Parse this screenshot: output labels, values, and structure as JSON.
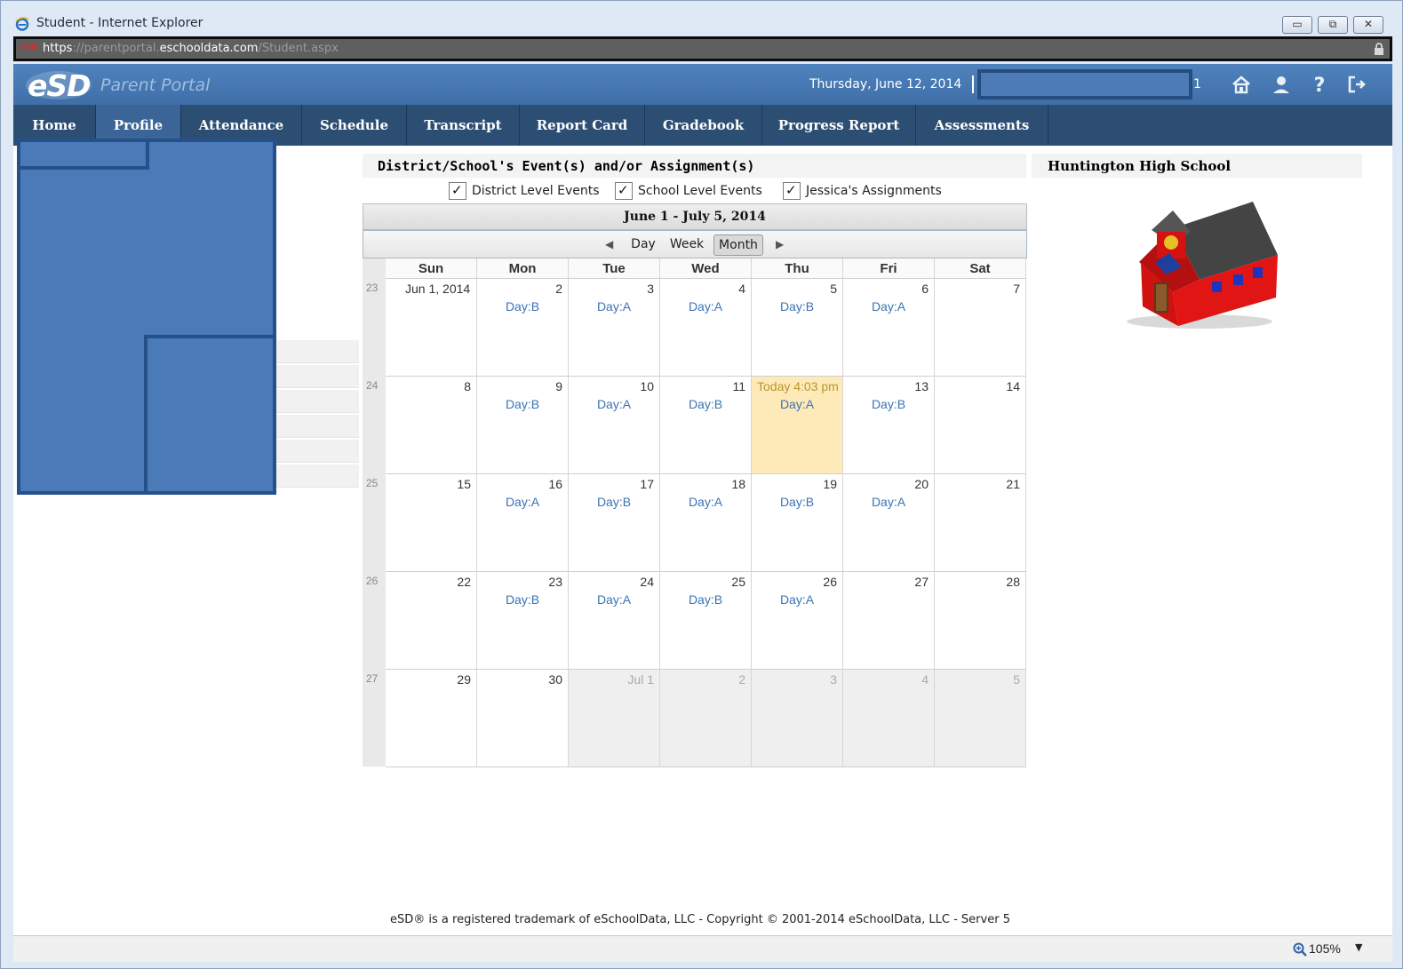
{
  "window": {
    "title": "Student - Internet Explorer",
    "url_scheme": "https",
    "url_pre": "://parentportal.",
    "url_domain": "eschooldata.com",
    "url_path": "/Student.aspx",
    "site_badge": "eSD"
  },
  "header": {
    "logo": "eSD",
    "portal_name": "Parent Portal",
    "date": "Thursday, June 12, 2014",
    "user_suffix": "1"
  },
  "nav": {
    "items": [
      {
        "label": "Home"
      },
      {
        "label": "Profile",
        "active": true
      },
      {
        "label": "Attendance"
      },
      {
        "label": "Schedule"
      },
      {
        "label": "Transcript"
      },
      {
        "label": "Report Card"
      },
      {
        "label": "Gradebook"
      },
      {
        "label": "Progress Report"
      },
      {
        "label": "Assessments"
      }
    ]
  },
  "events": {
    "title": "District/School's Event(s) and/or Assignment(s)",
    "filters": [
      {
        "label": "District Level Events",
        "checked": true
      },
      {
        "label": "School Level Events",
        "checked": true
      },
      {
        "label": "Jessica's Assignments",
        "checked": true
      }
    ]
  },
  "calendar": {
    "range": "June 1 - July 5, 2014",
    "views": [
      "Day",
      "Week",
      "Month"
    ],
    "active_view": "Month",
    "days": [
      "Sun",
      "Mon",
      "Tue",
      "Wed",
      "Thu",
      "Fri",
      "Sat"
    ],
    "weeks": [
      {
        "num": "23",
        "cells": [
          {
            "label": "Jun 1, 2014"
          },
          {
            "label": "2",
            "event": "Day:B"
          },
          {
            "label": "3",
            "event": "Day:A"
          },
          {
            "label": "4",
            "event": "Day:A"
          },
          {
            "label": "5",
            "event": "Day:B"
          },
          {
            "label": "6",
            "event": "Day:A"
          },
          {
            "label": "7"
          }
        ]
      },
      {
        "num": "24",
        "cells": [
          {
            "label": "8"
          },
          {
            "label": "9",
            "event": "Day:B"
          },
          {
            "label": "10",
            "event": "Day:A"
          },
          {
            "label": "11",
            "event": "Day:B"
          },
          {
            "label": "Today 4:03 pm",
            "event": "Day:A",
            "today": true
          },
          {
            "label": "13",
            "event": "Day:B"
          },
          {
            "label": "14"
          }
        ]
      },
      {
        "num": "25",
        "cells": [
          {
            "label": "15"
          },
          {
            "label": "16",
            "event": "Day:A"
          },
          {
            "label": "17",
            "event": "Day:B"
          },
          {
            "label": "18",
            "event": "Day:A"
          },
          {
            "label": "19",
            "event": "Day:B"
          },
          {
            "label": "20",
            "event": "Day:A"
          },
          {
            "label": "21"
          }
        ]
      },
      {
        "num": "26",
        "cells": [
          {
            "label": "22"
          },
          {
            "label": "23",
            "event": "Day:B"
          },
          {
            "label": "24",
            "event": "Day:A"
          },
          {
            "label": "25",
            "event": "Day:B"
          },
          {
            "label": "26",
            "event": "Day:A"
          },
          {
            "label": "27"
          },
          {
            "label": "28"
          }
        ]
      },
      {
        "num": "27",
        "cells": [
          {
            "label": "29"
          },
          {
            "label": "30"
          },
          {
            "label": "Jul 1",
            "other": true
          },
          {
            "label": "2",
            "other": true
          },
          {
            "label": "3",
            "other": true
          },
          {
            "label": "4",
            "other": true
          },
          {
            "label": "5",
            "other": true
          }
        ]
      }
    ]
  },
  "school": {
    "name": "Huntington High School",
    "image_icon": "schoolhouse-icon"
  },
  "footer": "eSD® is a registered trademark of eSchoolData, LLC - Copyright © 2001-2014 eSchoolData, LLC - Server 5",
  "statusbar": {
    "zoom": "105%"
  },
  "colors": {
    "header": "#4a7db8",
    "nav": "#2d4e73",
    "event_text": "#3a73b4",
    "today": "#fdeab8"
  }
}
